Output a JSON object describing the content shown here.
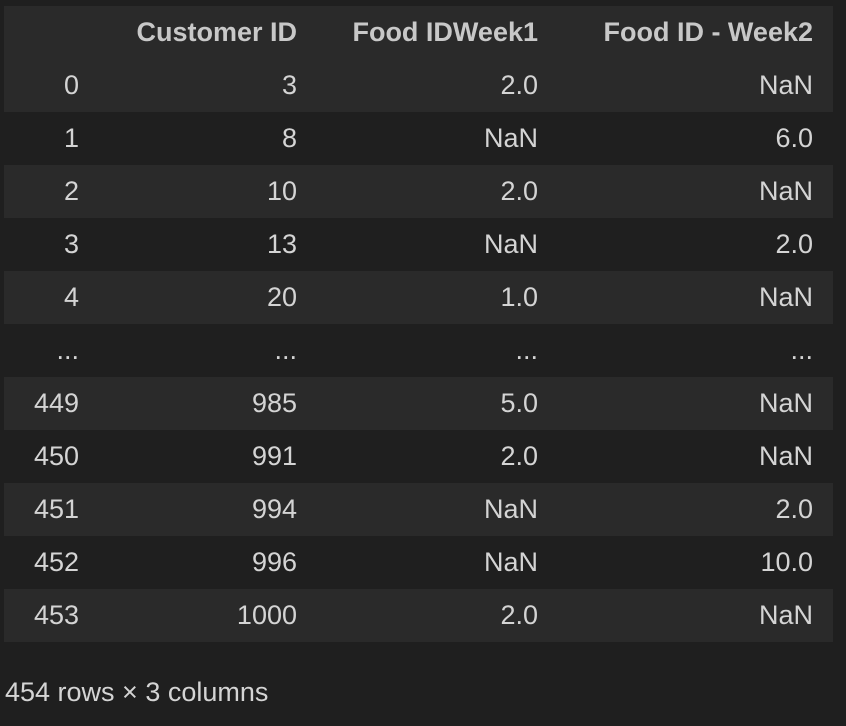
{
  "table": {
    "columns": [
      "",
      "Customer ID",
      "Food IDWeek1",
      "Food ID - Week2"
    ],
    "rows": [
      {
        "index": "0",
        "cells": [
          "3",
          "2.0",
          "NaN"
        ]
      },
      {
        "index": "1",
        "cells": [
          "8",
          "NaN",
          "6.0"
        ]
      },
      {
        "index": "2",
        "cells": [
          "10",
          "2.0",
          "NaN"
        ]
      },
      {
        "index": "3",
        "cells": [
          "13",
          "NaN",
          "2.0"
        ]
      },
      {
        "index": "4",
        "cells": [
          "20",
          "1.0",
          "NaN"
        ]
      },
      {
        "index": "...",
        "cells": [
          "...",
          "...",
          "..."
        ]
      },
      {
        "index": "449",
        "cells": [
          "985",
          "5.0",
          "NaN"
        ]
      },
      {
        "index": "450",
        "cells": [
          "991",
          "2.0",
          "NaN"
        ]
      },
      {
        "index": "451",
        "cells": [
          "994",
          "NaN",
          "2.0"
        ]
      },
      {
        "index": "452",
        "cells": [
          "996",
          "NaN",
          "10.0"
        ]
      },
      {
        "index": "453",
        "cells": [
          "1000",
          "2.0",
          "NaN"
        ]
      }
    ]
  },
  "shape_info": "454 rows × 3 columns",
  "colors": {
    "background": "#1f1f1f",
    "stripe": "#2a2a2a",
    "text": "#d4d4d4"
  }
}
